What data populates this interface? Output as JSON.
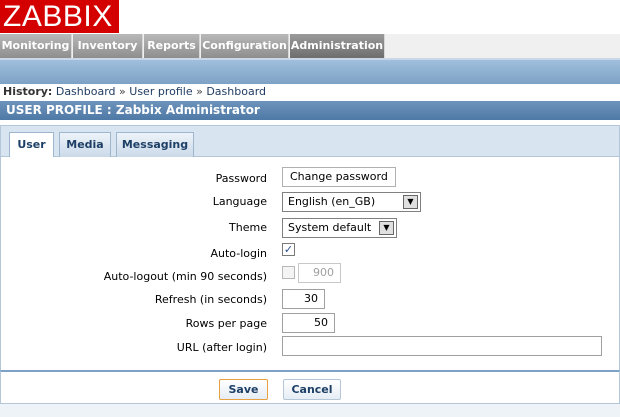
{
  "app": {
    "logo": "ZABBIX"
  },
  "menu": {
    "items": [
      {
        "label": "Monitoring"
      },
      {
        "label": "Inventory"
      },
      {
        "label": "Reports"
      },
      {
        "label": "Configuration"
      },
      {
        "label": "Administration"
      }
    ],
    "selected": "Administration"
  },
  "history": {
    "label": "History:",
    "items": [
      "Dashboard",
      "User profile",
      "Dashboard"
    ],
    "separator": "»"
  },
  "page": {
    "title": "USER PROFILE : Zabbix Administrator"
  },
  "tabs": [
    {
      "label": "User"
    },
    {
      "label": "Media"
    },
    {
      "label": "Messaging"
    }
  ],
  "active_tab": "User",
  "form": {
    "password": {
      "label": "Password",
      "button": "Change password"
    },
    "language": {
      "label": "Language",
      "value": "English (en_GB)"
    },
    "theme": {
      "label": "Theme",
      "value": "System default"
    },
    "autologin": {
      "label": "Auto-login",
      "checked": true,
      "mark": "✓"
    },
    "autologout": {
      "label": "Auto-logout (min 90 seconds)",
      "checked": false,
      "value": "900"
    },
    "refresh": {
      "label": "Refresh (in seconds)",
      "value": "30"
    },
    "rows": {
      "label": "Rows per page",
      "value": "50"
    },
    "url": {
      "label": "URL (after login)",
      "value": ""
    }
  },
  "footer": {
    "save": "Save",
    "cancel": "Cancel"
  },
  "colors": {
    "logo_bg": "#d40000",
    "menu_bg": "#9e9e9e",
    "title_bg": "#5b84b1",
    "tab_text": "#1d3f66",
    "save_border": "#e8a040"
  }
}
